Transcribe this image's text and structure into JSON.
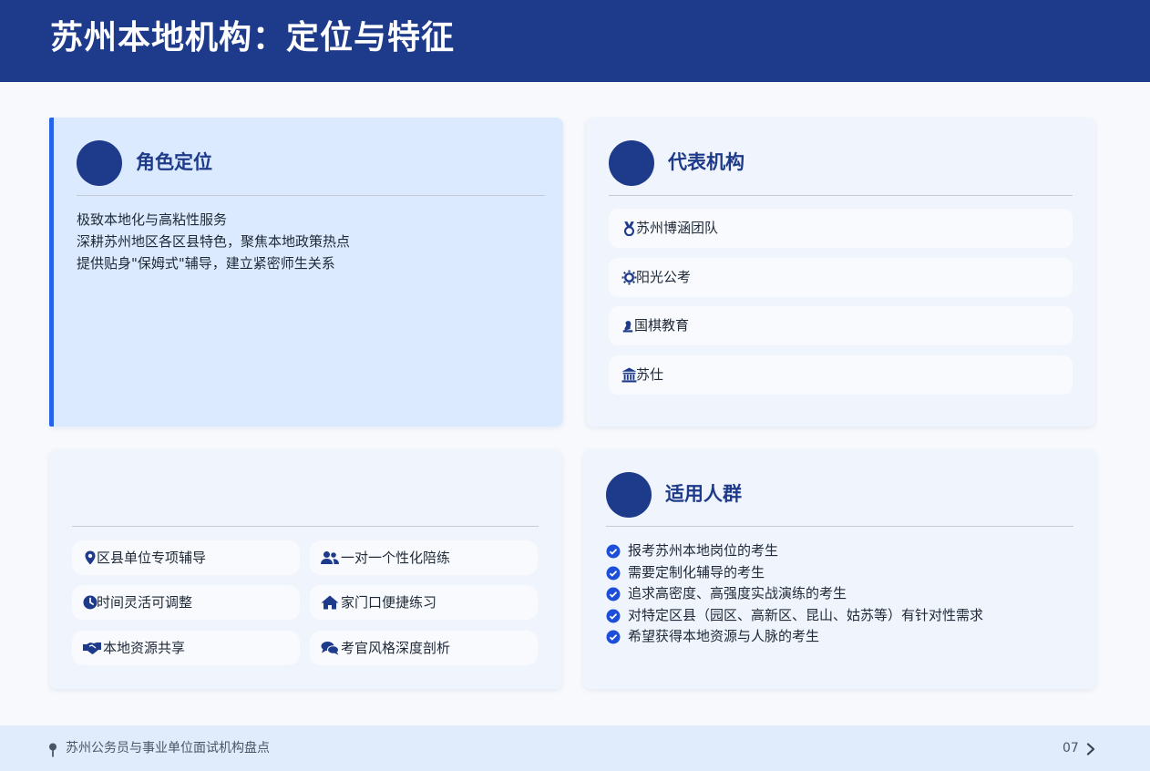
{
  "header": {
    "title": "苏州本地机构：定位与特征"
  },
  "role": {
    "title": "角色定位",
    "lines": [
      "极致本地化与高粘性服务",
      "深耕苏州地区各区县特色，聚焦本地政策热点",
      "提供贴身\"保姆式\"辅导，建立紧密师生关系"
    ]
  },
  "orgs": {
    "title": "代表机构",
    "items": [
      {
        "label": "苏州博涵团队",
        "icon": "medal-icon"
      },
      {
        "label": "阳光公考",
        "icon": "sun-icon"
      },
      {
        "label": "国棋教育",
        "icon": "chess-icon"
      },
      {
        "label": "苏仕",
        "icon": "bank-icon"
      }
    ]
  },
  "features": {
    "items": [
      {
        "label": "区县单位专项辅导",
        "icon": "location-pin-icon"
      },
      {
        "label": "一对一个性化陪练",
        "icon": "users-icon"
      },
      {
        "label": "时间灵活可调整",
        "icon": "clock-icon"
      },
      {
        "label": "家门口便捷练习",
        "icon": "home-icon"
      },
      {
        "label": "本地资源共享",
        "icon": "handshake-icon"
      },
      {
        "label": "考官风格深度剖析",
        "icon": "comments-icon"
      }
    ]
  },
  "people": {
    "title": "适用人群",
    "items": [
      "报考苏州本地岗位的考生",
      "需要定制化辅导的考生",
      "追求高密度、高强度实战演练的考生",
      "对特定区县（园区、高新区、昆山、姑苏等）有针对性需求",
      "希望获得本地资源与人脉的考生"
    ]
  },
  "footer": {
    "text": "苏州公务员与事业单位面试机构盘点",
    "page": "07"
  },
  "colors": {
    "primary": "#1e3a8a",
    "accent": "#2563eb",
    "card": "#eff4fd",
    "highlight": "#dbeafe"
  }
}
